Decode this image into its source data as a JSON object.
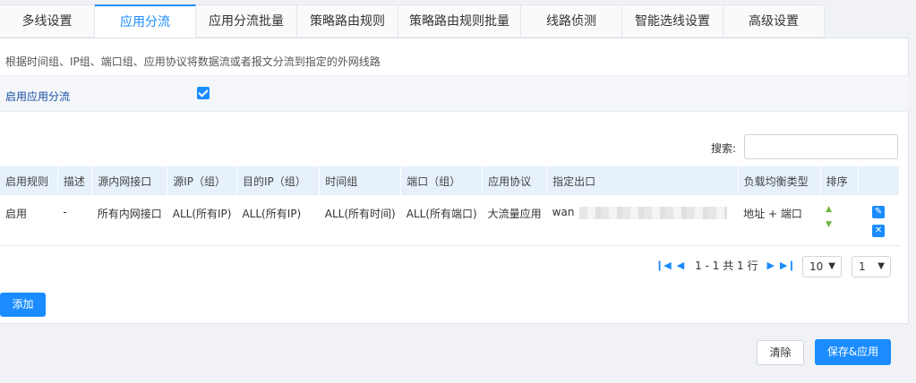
{
  "tabs": [
    {
      "label": "多线设置"
    },
    {
      "label": "应用分流"
    },
    {
      "label": "应用分流批量"
    },
    {
      "label": "策略路由规则"
    },
    {
      "label": "策略路由规则批量"
    },
    {
      "label": "线路侦测"
    },
    {
      "label": "智能选线设置"
    },
    {
      "label": "高级设置"
    }
  ],
  "description": "根据时间组、IP组、端口组、应用协议将数据流或者报文分流到指定的外网线路",
  "enable": {
    "label": "启用应用分流",
    "checked": true
  },
  "search": {
    "label": "搜索:",
    "value": ""
  },
  "table": {
    "headers": [
      "启用规则",
      "描述",
      "源内网接口",
      "源IP（组）",
      "目的IP（组）",
      "时间组",
      "端口（组）",
      "应用协议",
      "指定出口",
      "负载均衡类型",
      "排序",
      ""
    ],
    "rows": [
      {
        "enabled": "启用",
        "desc": "-",
        "src_iface": "所有内网接口",
        "src_ip": "ALL(所有IP)",
        "dst_ip": "ALL(所有IP)",
        "time_group": "ALL(所有时间)",
        "port": "ALL(所有端口)",
        "protocol": "大流量应用",
        "egress": "wan",
        "lb_type": "地址 + 端口"
      }
    ]
  },
  "pager": {
    "text": "1 - 1 共 1 行",
    "page_size": "10",
    "page": "1"
  },
  "buttons": {
    "add": "添加",
    "clear": "清除",
    "save": "保存&应用"
  },
  "icons": {
    "first": "first-page-icon",
    "prev": "prev-page-icon",
    "next": "next-page-icon",
    "last": "last-page-icon",
    "up": "move-up-icon",
    "down": "move-down-icon",
    "edit": "edit-icon",
    "delete": "delete-icon"
  },
  "colors": {
    "accent": "#1a8cff",
    "header_bg": "#e6f1fb",
    "sort_arrow": "#6cb33e"
  }
}
